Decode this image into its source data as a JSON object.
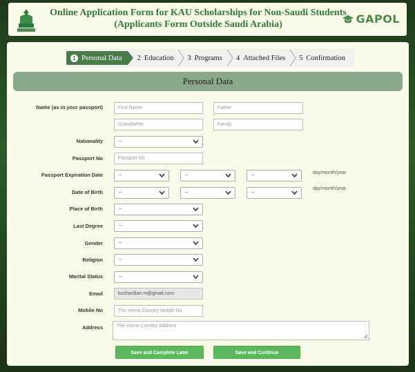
{
  "header": {
    "title_line1": "Online Application Form for KAU Scholarships for Non-Saudi Students",
    "title_line2": "(Applicants Form Outside Saudi Arabia)",
    "brand": "GAPOL"
  },
  "steps": [
    {
      "num": "1",
      "label": "Personal Data"
    },
    {
      "num": "2",
      "label": "Education"
    },
    {
      "num": "3",
      "label": "Programs"
    },
    {
      "num": "4",
      "label": "Attached Files"
    },
    {
      "num": "5",
      "label": "Confirmation"
    }
  ],
  "section_title": "Personal Data",
  "form": {
    "name_label": "Name (as in your passport)",
    "first_name_ph": "First Name",
    "father_ph": "Father",
    "grandfather_ph": "Grandfather",
    "family_ph": "Family",
    "nationality_label": "Nationality",
    "nationality_value": "--",
    "passport_no_label": "Passport No",
    "passport_no_ph": "Passport No",
    "passport_exp_label": "Passport Expiration Date",
    "passport_exp_day": "--",
    "passport_exp_month": "--",
    "passport_exp_year": "--",
    "dob_label": "Date of Birth",
    "dob_day": "--",
    "dob_month": "--",
    "dob_year": "--",
    "date_hint": "day/month/year",
    "pob_label": "Place of Birth",
    "pob_value": "--",
    "last_degree_label": "Last Degree",
    "last_degree_value": "--",
    "gender_label": "Gender",
    "gender_value": "--",
    "religion_label": "Religion",
    "religion_value": "--",
    "marital_label": "Marital Status",
    "marital_value": "--",
    "email_label": "Email",
    "email_value": "kushardian.m@gmail.com",
    "mobile_label": "Mobile No",
    "mobile_ph": "The Home Country Mobile No",
    "address_label": "Address",
    "address_ph": "The Home Country Address"
  },
  "buttons": {
    "save_later": "Save and Complete Later",
    "save_continue": "Save and Continue"
  },
  "colors": {
    "title_green": "#2e7a3c",
    "section_bar": "#8aa88a",
    "step_active": "#4a7a4a",
    "button_green": "#5cb85c"
  }
}
